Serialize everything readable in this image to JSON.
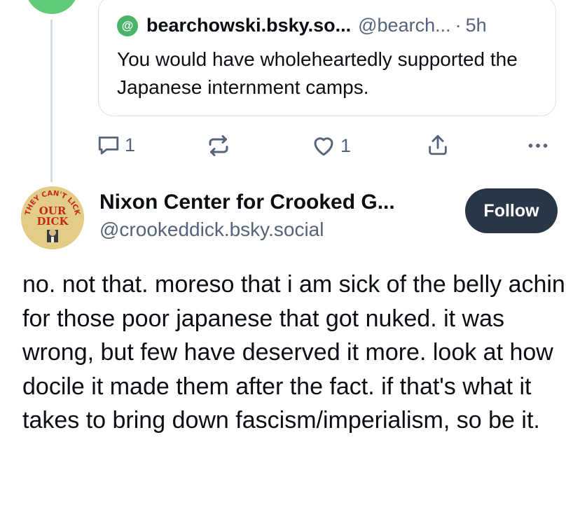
{
  "parent_post": {
    "avatar_color": "#5fcb78"
  },
  "quote": {
    "avatar_symbol": "@",
    "author_name": "bearchowski.bsky.so...",
    "author_handle": "@bearch...",
    "separator": "·",
    "time": "5h",
    "text": "You would have wholeheartedly supported the Japanese internment camps."
  },
  "actions": {
    "reply_count": "1",
    "like_count": "1",
    "icons": [
      "reply-icon",
      "repost-icon",
      "like-icon",
      "share-icon",
      "more-icon"
    ]
  },
  "post": {
    "avatar_text_top": "THEY CAN'T LICK",
    "avatar_text_middle": "OUR",
    "avatar_text_bottom": "DICK",
    "author_name": "Nixon Center for Crooked G...",
    "author_handle": "@crookeddick.bsky.social",
    "follow_label": "Follow",
    "text": "no. not that. moreso that i am sick of the belly achin for those poor japanese that got nuked. it was wrong, but few have deserved it more. look at how docile it made them after the fact. if that's what it takes to bring down fascism/imperialism, so be it."
  },
  "colors": {
    "text_primary": "#0b0f14",
    "text_secondary": "#55647a",
    "follow_bg": "#283645",
    "border": "#d9e0e7"
  }
}
